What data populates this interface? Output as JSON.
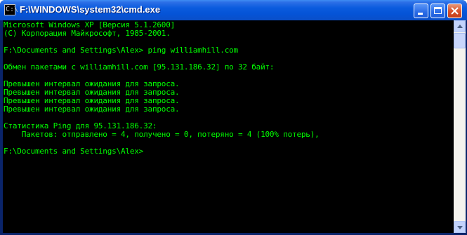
{
  "window": {
    "title": "F:\\WINDOWS\\system32\\cmd.exe",
    "icon": "cmd-icon",
    "icon_glyph": "C:\\"
  },
  "console": {
    "lines": [
      "Microsoft Windows XP [Версия 5.1.2600]",
      "(С) Корпорация Майкрософт, 1985-2001.",
      "",
      "F:\\Documents and Settings\\Alex> ping williamhill.com",
      "",
      "Обмен пакетами с williamhill.com [95.131.186.32] по 32 байт:",
      "",
      "Превышен интервал ожидания для запроса.",
      "Превышен интервал ожидания для запроса.",
      "Превышен интервал ожидания для запроса.",
      "Превышен интервал ожидания для запроса.",
      "",
      "Статистика Ping для 95.131.186.32:",
      "    Пакетов: отправлено = 4, получено = 0, потеряно = 4 (100% потерь),",
      "",
      "F:\\Documents and Settings\\Alex>"
    ],
    "text_color": "#00ff00",
    "background": "#000000"
  },
  "colors": {
    "titlebar": "#0a5bde",
    "close_button": "#d9532d"
  }
}
